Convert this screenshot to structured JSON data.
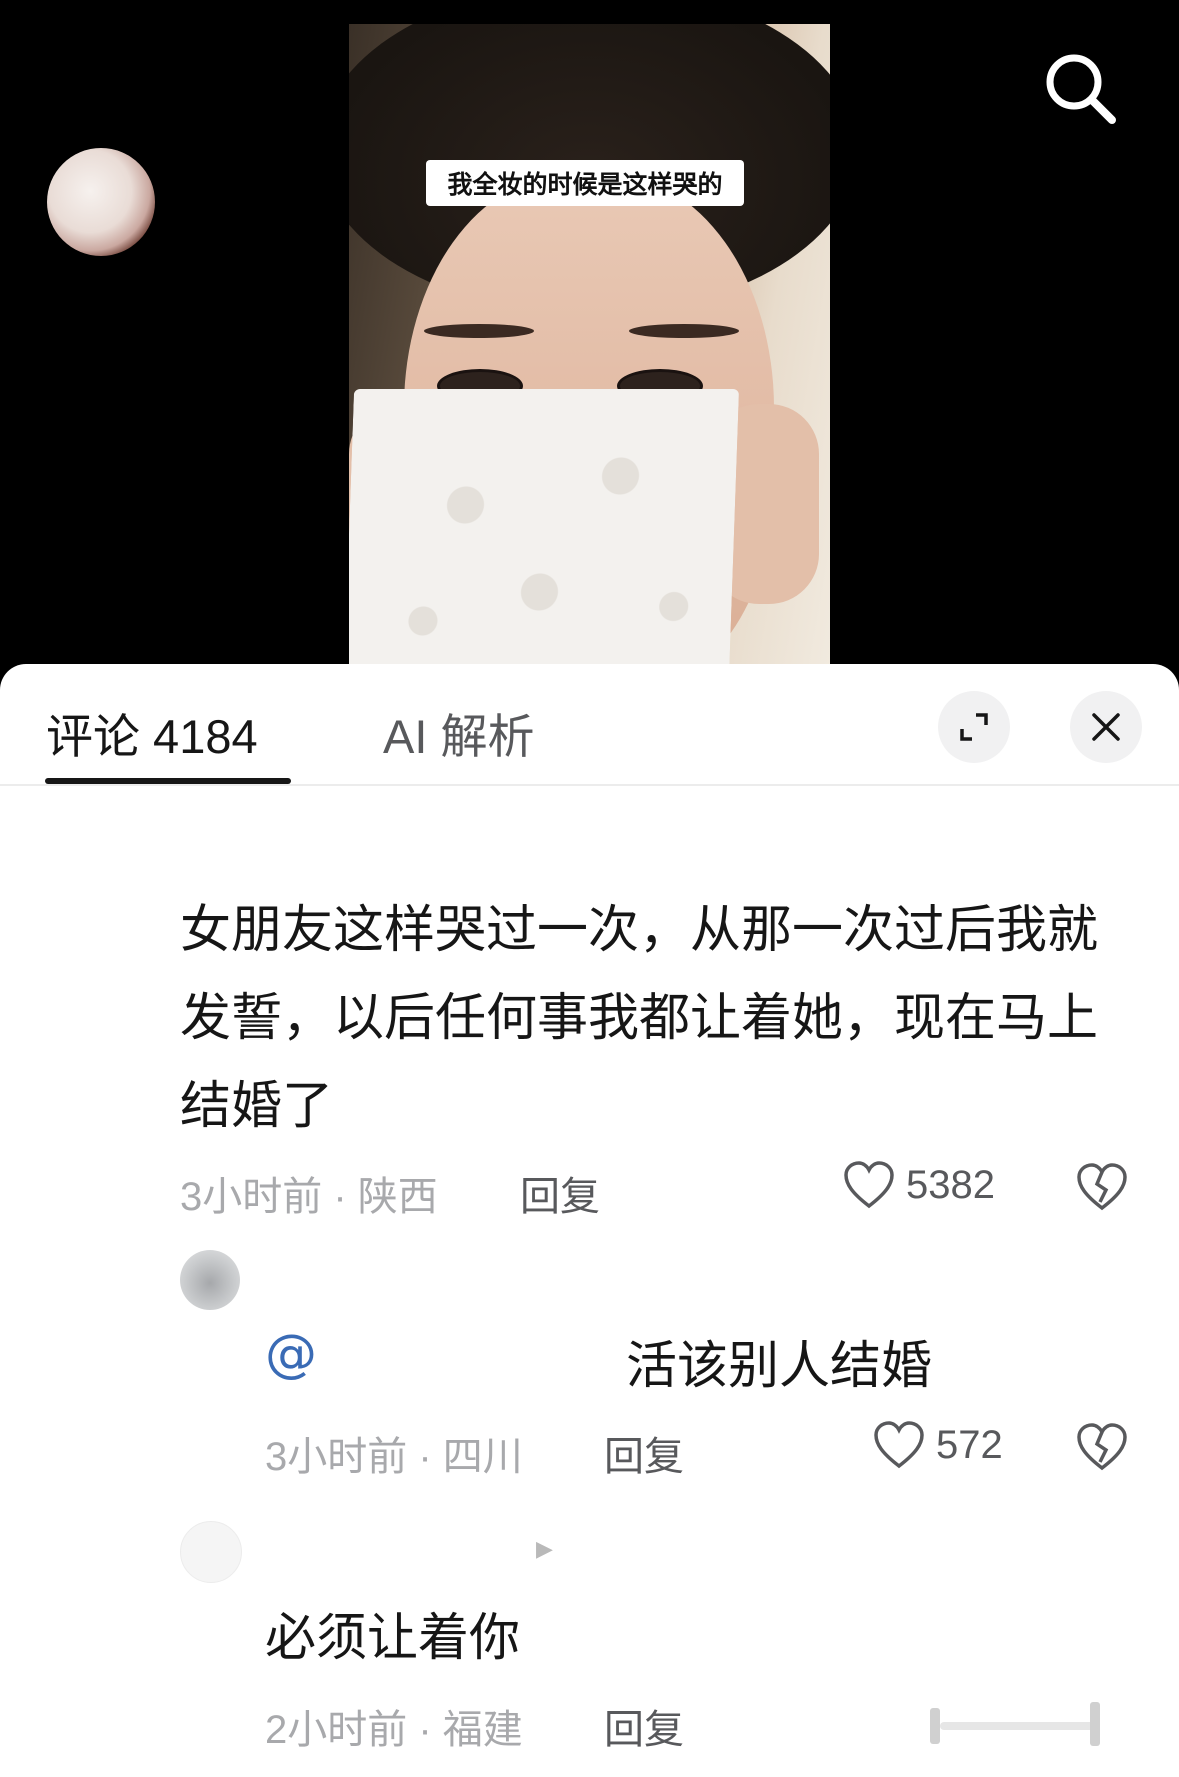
{
  "video": {
    "caption": "我全妆的时候是这样哭的"
  },
  "tabs": {
    "comments_label": "评论 4184",
    "ai_label": "AI 解析"
  },
  "icons": {
    "search": "search-icon",
    "expand": "expand-icon",
    "close": "close-icon",
    "heart": "heart-outline-icon",
    "broken_heart": "broken-heart-icon"
  },
  "comments": [
    {
      "text": "女朋友这样哭过一次，从那一次过后我就发誓，以后任何事我都让着她，现在马上结婚了",
      "meta": "3小时前 · 陕西",
      "reply_label": "回复",
      "likes": "5382"
    }
  ],
  "replies": [
    {
      "mention": "@",
      "text": "活该别人结婚",
      "meta": "3小时前 · 四川",
      "reply_label": "回复",
      "likes": "572"
    },
    {
      "text": "必须让着你",
      "meta": "2小时前 · 福建",
      "reply_label": "回复"
    }
  ],
  "colors": {
    "text_primary": "#161616",
    "text_secondary": "#a8a9ac",
    "mention": "#3a6bb5",
    "sheet_bg": "#ffffff",
    "video_bg": "#000000"
  }
}
